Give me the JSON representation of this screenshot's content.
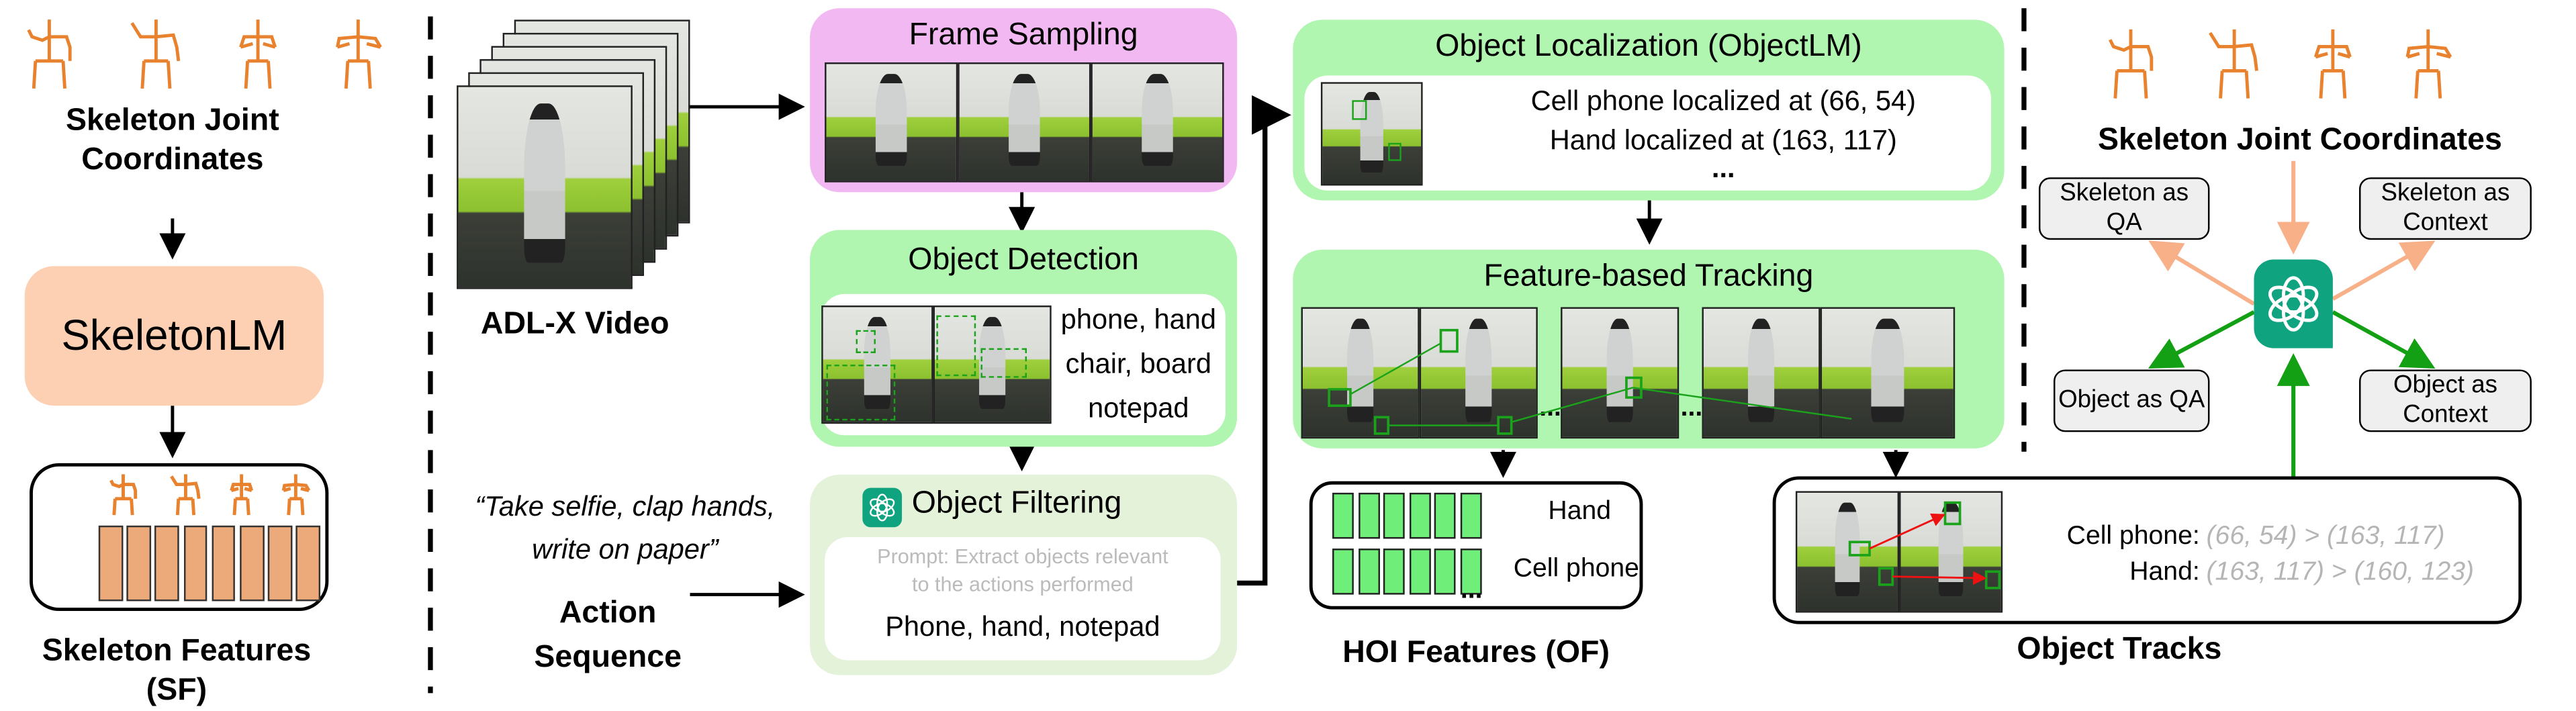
{
  "left": {
    "skeleton_label": [
      "Skeleton Joint",
      "Coordinates"
    ],
    "model": "SkeletonLM",
    "features_label": "Skeleton Features (SF)"
  },
  "video": {
    "label": "ADL-X Video"
  },
  "action": {
    "quote": [
      "“Take selfie, clap hands,",
      "write on paper”"
    ],
    "label": [
      "Action",
      "Sequence"
    ]
  },
  "frame_sampling": {
    "title": "Frame Sampling"
  },
  "object_detection": {
    "title": "Object Detection",
    "objects": [
      "phone, hand",
      "chair, board",
      "notepad"
    ]
  },
  "object_filtering": {
    "title": "Object Filtering",
    "prompt": [
      "Prompt: Extract objects relevant",
      "to the actions performed"
    ],
    "result": "Phone, hand, notepad"
  },
  "localization": {
    "title": "Object Localization (ObjectLM)",
    "lines": [
      "Cell phone localized at (66, 54)",
      "Hand localized at (163, 117)",
      "..."
    ]
  },
  "tracking": {
    "title": "Feature-based Tracking",
    "ellipsis": "..."
  },
  "hoi": {
    "rows": [
      "Hand",
      "Cell phone"
    ],
    "ellipsis": "...",
    "label": "HOI Features (OF)"
  },
  "right": {
    "skeleton_label": "Skeleton Joint Coordinates",
    "skeleton_qa": "Skeleton as QA",
    "skeleton_context": [
      "Skeleton as",
      "Context"
    ],
    "object_qa": "Object as QA",
    "object_context": [
      "Object as",
      "Context"
    ]
  },
  "tracks": {
    "label": "Object Tracks",
    "rows": [
      {
        "name": "Cell phone:",
        "value": "(66, 54) > (163, 117)"
      },
      {
        "name": "Hand:",
        "value": "(163, 117) > (160, 123)"
      }
    ]
  },
  "colors": {
    "skeleton": "#e8822e",
    "skeletonlm": "#fdd0b3",
    "frame_sampling": "#f2b8f2",
    "green_module": "#b0f5b0",
    "filtering": "#e3f2d9",
    "gpt": "#10a37f",
    "track_arrow": "#ee1111",
    "skeleton_arrow": "#f8b088",
    "object_arrow": "#14a014"
  }
}
